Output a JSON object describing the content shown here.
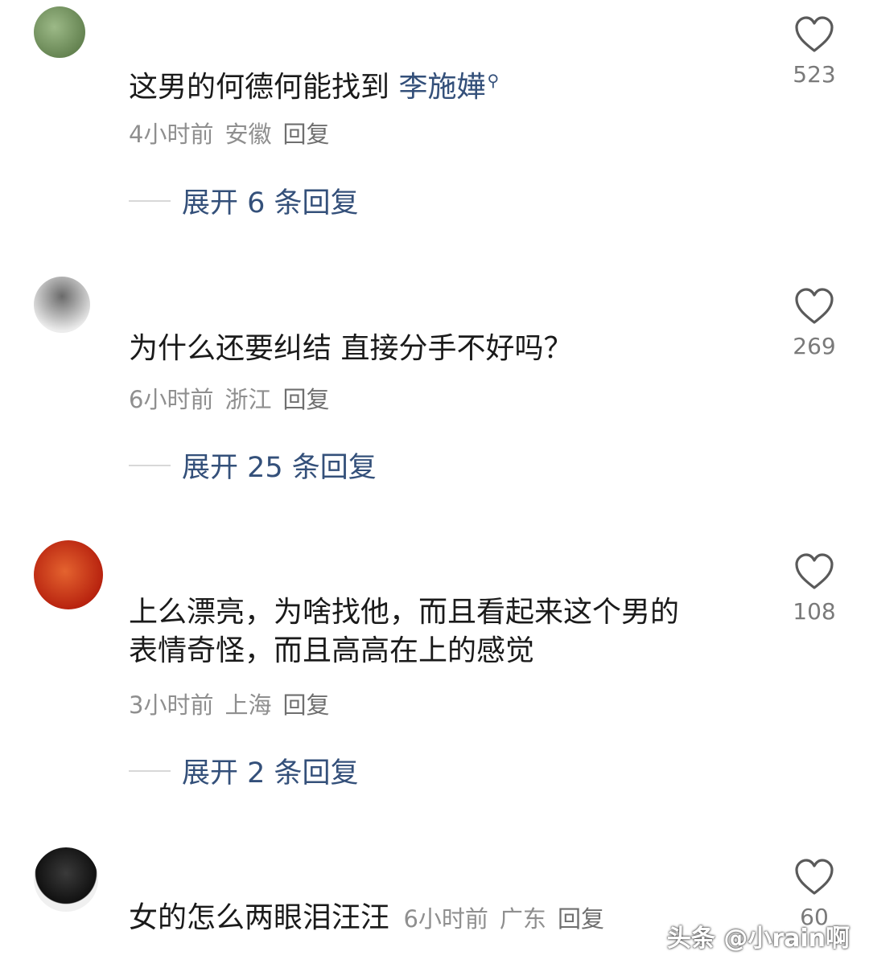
{
  "comments": [
    {
      "username": "",
      "body": "这男的何德何能找到 ",
      "mention": "李施嬅",
      "time": "4小时前",
      "region": "安徽",
      "reply_label": "回复",
      "expand_label": "展开 6 条回复",
      "likes": "523",
      "avatar_color": "#6e8f5a"
    },
    {
      "username": "",
      "body": "为什么还要纠结 直接分手不好吗？",
      "time": "6小时前",
      "region": "浙江",
      "reply_label": "回复",
      "expand_label": "展开 25 条回复",
      "likes": "269",
      "avatar_color": "#3a3a3a"
    },
    {
      "username": "",
      "body_line1": "上么漂亮，为啥找他，而且看起来这个男的",
      "body_line2": "表情奇怪，而且高高在上的感觉",
      "time": "3小时前",
      "region": "上海",
      "reply_label": "回复",
      "expand_label": "展开 2 条回复",
      "likes": "108",
      "avatar_color": "#c8351e"
    },
    {
      "username": "",
      "body": "女的怎么两眼泪汪汪",
      "time": "6小时前",
      "region": "广东",
      "reply_label": "回复",
      "likes": "60",
      "avatar_color": "#1c1c1c"
    }
  ],
  "watermark": "头条 @小rain啊",
  "icons": {
    "like": "heart-outline-icon",
    "mention": "search-icon"
  },
  "colors": {
    "link": "#34507a",
    "meta": "#8f8f8f",
    "body": "#1a1a1a"
  }
}
